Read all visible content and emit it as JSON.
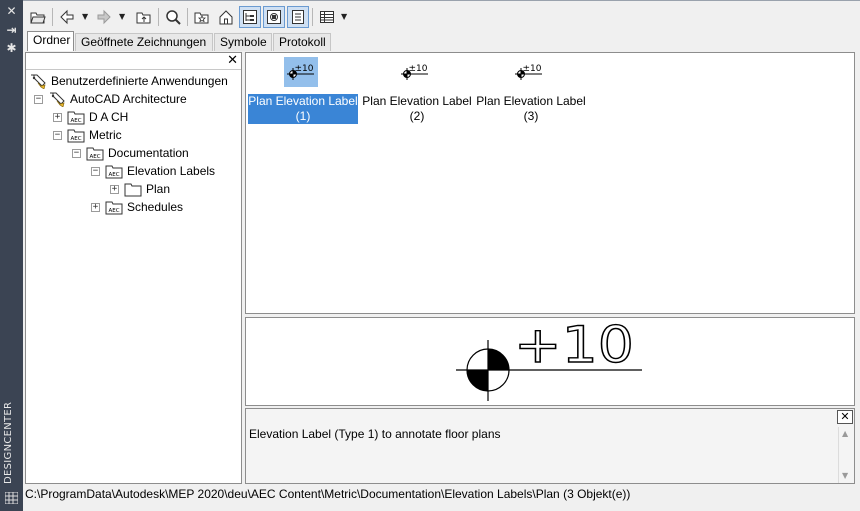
{
  "sidebar": {
    "title": "DESIGNCENTER",
    "close_icon": "close-icon",
    "pin_icon": "auto-hide-icon",
    "properties_icon": "properties-icon",
    "menu_icon": "palette-menu-icon"
  },
  "toolbar": {
    "buttons": [
      "load-folder-icon",
      "back-icon",
      "forward-icon",
      "up-icon",
      "search-icon",
      "favorites-icon",
      "home-icon",
      "tree-view-toggle-icon",
      "preview-toggle-icon",
      "description-toggle-icon",
      "views-icon"
    ]
  },
  "tabs": [
    "Ordner",
    "Geöffnete Zeichnungen",
    "Symbole",
    "Protokoll"
  ],
  "tree": {
    "nodes": [
      {
        "label": "Benutzerdefinierte Anwendungen"
      },
      {
        "label": "AutoCAD Architecture"
      },
      {
        "label": "D A CH"
      },
      {
        "label": "Metric"
      },
      {
        "label": "Documentation"
      },
      {
        "label": "Elevation Labels"
      },
      {
        "label": "Plan"
      },
      {
        "label": "Schedules"
      }
    ]
  },
  "items": [
    {
      "label": "Plan Elevation Label",
      "index": "(1)",
      "thumb_text": "±10",
      "selected": true
    },
    {
      "label": "Plan Elevation Label",
      "index": "(2)",
      "thumb_text": "±10",
      "selected": false
    },
    {
      "label": "Plan Elevation Label",
      "index": "(3)",
      "thumb_text": "±10",
      "selected": false
    }
  ],
  "preview": {
    "text": "+10"
  },
  "description": {
    "text": "Elevation Label (Type 1) to annotate floor plans"
  },
  "status": {
    "path": "C:\\ProgramData\\Autodesk\\MEP 2020\\deu\\AEC Content\\Metric\\Documentation\\Elevation Labels\\Plan (3 Objekt(e))"
  },
  "colors": {
    "strip": "#3b4453",
    "selection": "#3a85d6"
  }
}
